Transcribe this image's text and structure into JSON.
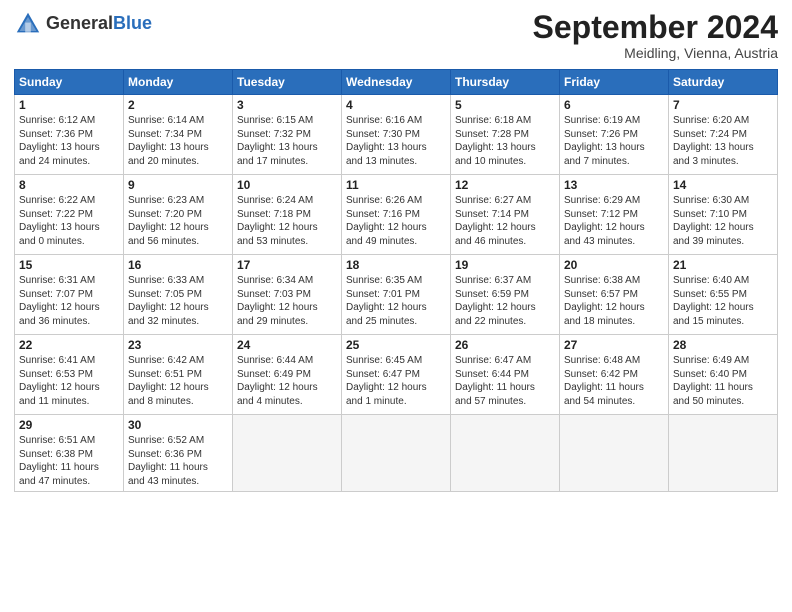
{
  "header": {
    "logo_general": "General",
    "logo_blue": "Blue",
    "month_title": "September 2024",
    "location": "Meidling, Vienna, Austria"
  },
  "weekdays": [
    "Sunday",
    "Monday",
    "Tuesday",
    "Wednesday",
    "Thursday",
    "Friday",
    "Saturday"
  ],
  "weeks": [
    [
      {
        "day": "1",
        "info": "Sunrise: 6:12 AM\nSunset: 7:36 PM\nDaylight: 13 hours\nand 24 minutes."
      },
      {
        "day": "2",
        "info": "Sunrise: 6:14 AM\nSunset: 7:34 PM\nDaylight: 13 hours\nand 20 minutes."
      },
      {
        "day": "3",
        "info": "Sunrise: 6:15 AM\nSunset: 7:32 PM\nDaylight: 13 hours\nand 17 minutes."
      },
      {
        "day": "4",
        "info": "Sunrise: 6:16 AM\nSunset: 7:30 PM\nDaylight: 13 hours\nand 13 minutes."
      },
      {
        "day": "5",
        "info": "Sunrise: 6:18 AM\nSunset: 7:28 PM\nDaylight: 13 hours\nand 10 minutes."
      },
      {
        "day": "6",
        "info": "Sunrise: 6:19 AM\nSunset: 7:26 PM\nDaylight: 13 hours\nand 7 minutes."
      },
      {
        "day": "7",
        "info": "Sunrise: 6:20 AM\nSunset: 7:24 PM\nDaylight: 13 hours\nand 3 minutes."
      }
    ],
    [
      {
        "day": "8",
        "info": "Sunrise: 6:22 AM\nSunset: 7:22 PM\nDaylight: 13 hours\nand 0 minutes."
      },
      {
        "day": "9",
        "info": "Sunrise: 6:23 AM\nSunset: 7:20 PM\nDaylight: 12 hours\nand 56 minutes."
      },
      {
        "day": "10",
        "info": "Sunrise: 6:24 AM\nSunset: 7:18 PM\nDaylight: 12 hours\nand 53 minutes."
      },
      {
        "day": "11",
        "info": "Sunrise: 6:26 AM\nSunset: 7:16 PM\nDaylight: 12 hours\nand 49 minutes."
      },
      {
        "day": "12",
        "info": "Sunrise: 6:27 AM\nSunset: 7:14 PM\nDaylight: 12 hours\nand 46 minutes."
      },
      {
        "day": "13",
        "info": "Sunrise: 6:29 AM\nSunset: 7:12 PM\nDaylight: 12 hours\nand 43 minutes."
      },
      {
        "day": "14",
        "info": "Sunrise: 6:30 AM\nSunset: 7:10 PM\nDaylight: 12 hours\nand 39 minutes."
      }
    ],
    [
      {
        "day": "15",
        "info": "Sunrise: 6:31 AM\nSunset: 7:07 PM\nDaylight: 12 hours\nand 36 minutes."
      },
      {
        "day": "16",
        "info": "Sunrise: 6:33 AM\nSunset: 7:05 PM\nDaylight: 12 hours\nand 32 minutes."
      },
      {
        "day": "17",
        "info": "Sunrise: 6:34 AM\nSunset: 7:03 PM\nDaylight: 12 hours\nand 29 minutes."
      },
      {
        "day": "18",
        "info": "Sunrise: 6:35 AM\nSunset: 7:01 PM\nDaylight: 12 hours\nand 25 minutes."
      },
      {
        "day": "19",
        "info": "Sunrise: 6:37 AM\nSunset: 6:59 PM\nDaylight: 12 hours\nand 22 minutes."
      },
      {
        "day": "20",
        "info": "Sunrise: 6:38 AM\nSunset: 6:57 PM\nDaylight: 12 hours\nand 18 minutes."
      },
      {
        "day": "21",
        "info": "Sunrise: 6:40 AM\nSunset: 6:55 PM\nDaylight: 12 hours\nand 15 minutes."
      }
    ],
    [
      {
        "day": "22",
        "info": "Sunrise: 6:41 AM\nSunset: 6:53 PM\nDaylight: 12 hours\nand 11 minutes."
      },
      {
        "day": "23",
        "info": "Sunrise: 6:42 AM\nSunset: 6:51 PM\nDaylight: 12 hours\nand 8 minutes."
      },
      {
        "day": "24",
        "info": "Sunrise: 6:44 AM\nSunset: 6:49 PM\nDaylight: 12 hours\nand 4 minutes."
      },
      {
        "day": "25",
        "info": "Sunrise: 6:45 AM\nSunset: 6:47 PM\nDaylight: 12 hours\nand 1 minute."
      },
      {
        "day": "26",
        "info": "Sunrise: 6:47 AM\nSunset: 6:44 PM\nDaylight: 11 hours\nand 57 minutes."
      },
      {
        "day": "27",
        "info": "Sunrise: 6:48 AM\nSunset: 6:42 PM\nDaylight: 11 hours\nand 54 minutes."
      },
      {
        "day": "28",
        "info": "Sunrise: 6:49 AM\nSunset: 6:40 PM\nDaylight: 11 hours\nand 50 minutes."
      }
    ],
    [
      {
        "day": "29",
        "info": "Sunrise: 6:51 AM\nSunset: 6:38 PM\nDaylight: 11 hours\nand 47 minutes."
      },
      {
        "day": "30",
        "info": "Sunrise: 6:52 AM\nSunset: 6:36 PM\nDaylight: 11 hours\nand 43 minutes."
      },
      null,
      null,
      null,
      null,
      null
    ]
  ]
}
